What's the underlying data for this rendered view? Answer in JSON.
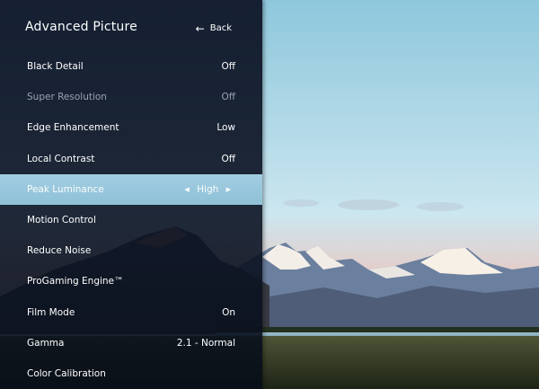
{
  "panel": {
    "title": "Advanced Picture",
    "back_label": "Back",
    "back_icon": "arrow-left-icon"
  },
  "menu": {
    "items": [
      {
        "label": "Black Detail",
        "value": "Off",
        "state": "normal"
      },
      {
        "label": "Super Resolution",
        "value": "Off",
        "state": "disabled"
      },
      {
        "label": "Edge Enhancement",
        "value": "Low",
        "state": "normal"
      },
      {
        "label": "Local Contrast",
        "value": "Off",
        "state": "normal"
      },
      {
        "label": "Peak Luminance",
        "value": "High",
        "state": "selected"
      },
      {
        "label": "Motion Control",
        "value": "",
        "state": "normal"
      },
      {
        "label": "Reduce Noise",
        "value": "",
        "state": "normal"
      },
      {
        "label": "ProGaming Engine™",
        "value": "",
        "state": "normal"
      },
      {
        "label": "Film Mode",
        "value": "On",
        "state": "normal"
      },
      {
        "label": "Gamma",
        "value": "2.1 - Normal",
        "state": "normal"
      },
      {
        "label": "Color Calibration",
        "value": "",
        "state": "normal"
      }
    ]
  },
  "colors": {
    "selected_bg": "#9ccbe0",
    "panel_bg": "#0e1628",
    "disabled_text": "#98a2b3"
  }
}
